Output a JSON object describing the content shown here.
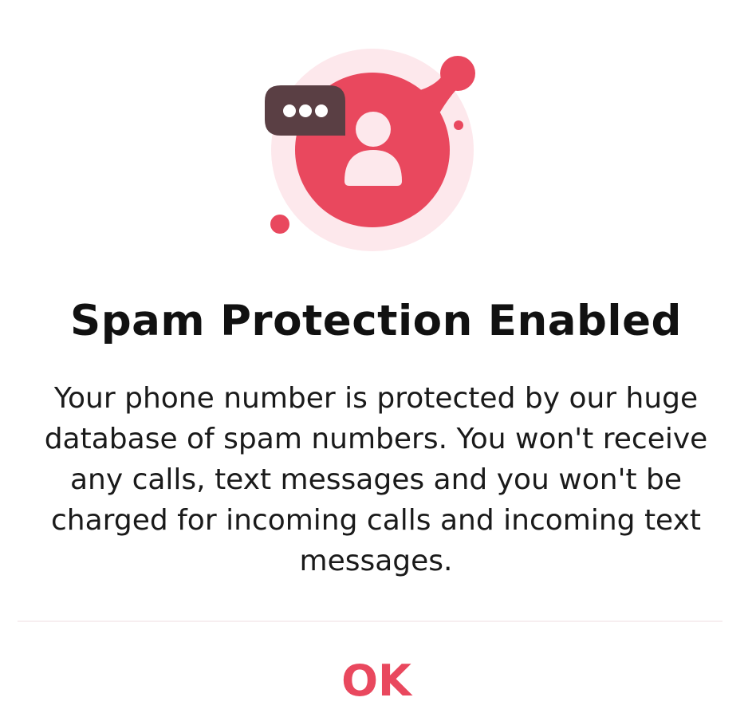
{
  "dialog": {
    "title": "Spam Protection Enabled",
    "message": "Your phone number is protected by our huge database of spam numbers. You won't receive any calls, text messages and you won't be charged for incoming calls and incoming text messages.",
    "ok_label": "OK"
  },
  "illustration": {
    "icon": "user-chat-shield-icon",
    "primary_color": "#e9485e",
    "light_color": "#fde8ec",
    "bubble_color": "#5a3f44"
  }
}
